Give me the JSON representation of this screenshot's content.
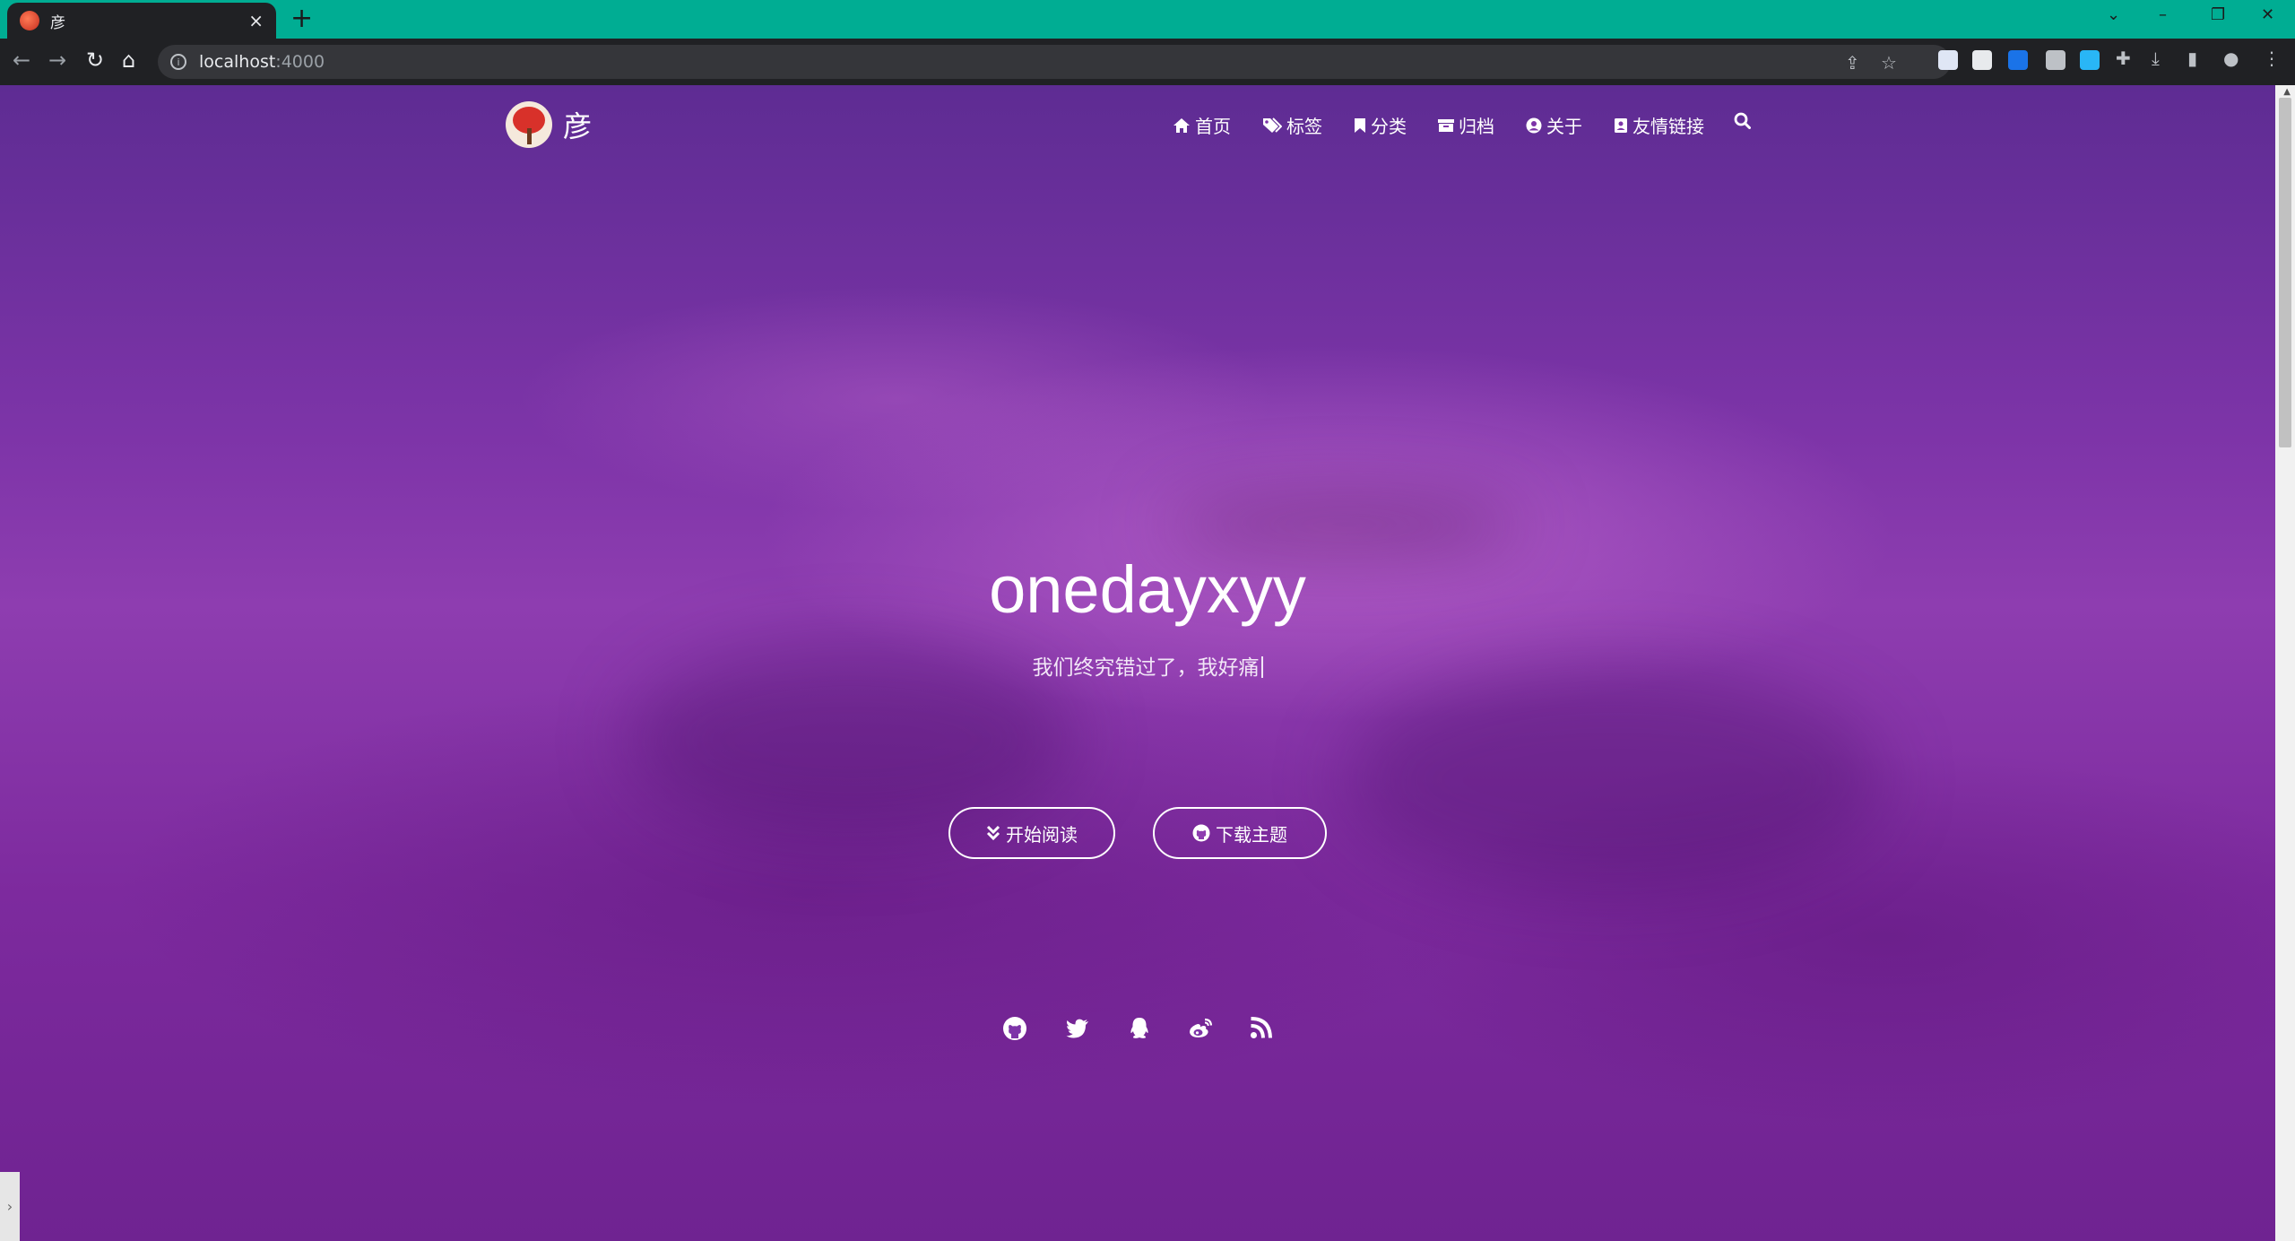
{
  "browser": {
    "tab_title": "彦",
    "tab_close": "×",
    "new_tab": "+",
    "url_host": "localhost",
    "url_port": ":4000",
    "window_controls": [
      "⌄",
      "–",
      "❐",
      "✕"
    ]
  },
  "site": {
    "logo_text": "彦",
    "nav": [
      {
        "label": "首页",
        "icon": "home-icon"
      },
      {
        "label": "标签",
        "icon": "tags-icon"
      },
      {
        "label": "分类",
        "icon": "bookmark-icon"
      },
      {
        "label": "归档",
        "icon": "archive-icon"
      },
      {
        "label": "关于",
        "icon": "user-circle-icon"
      },
      {
        "label": "友情链接",
        "icon": "address-book-icon"
      }
    ],
    "hero": {
      "title": "onedayxyy",
      "subtitle": "我们终究错过了，我好痛"
    },
    "buttons": {
      "start_reading": "开始阅读",
      "download_theme": "下载主题"
    },
    "social_icons": [
      "github-icon",
      "twitter-icon",
      "qq-icon",
      "weibo-icon",
      "rss-icon"
    ]
  },
  "colors": {
    "tabstrip": "#00ad93",
    "toolbar": "#202124",
    "hero_purple": "#8e3db0"
  }
}
